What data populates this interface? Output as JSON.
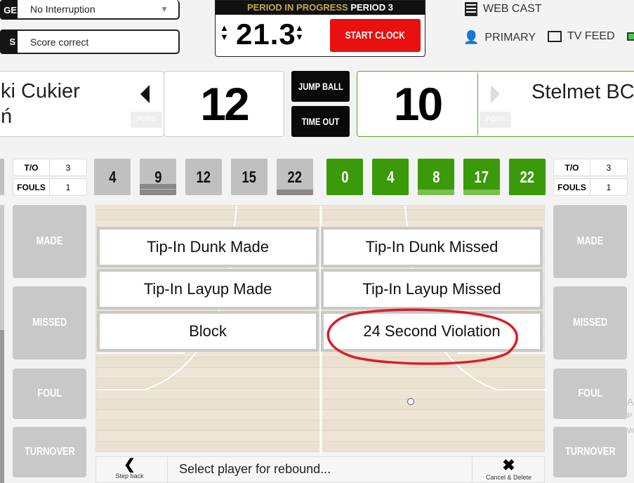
{
  "top_left": {
    "row1": {
      "label": "GE",
      "value": "No Interruption",
      "arrow": "▼"
    },
    "row2": {
      "label": "S",
      "value": "Score correct"
    }
  },
  "clock": {
    "status": "PERIOD IN PROGRESS",
    "period": "PERIOD 3",
    "time": "21.3",
    "start_label": "START CLOCK"
  },
  "top_right": {
    "webcast": "WEB CAST",
    "primary": "PRIMARY",
    "tv_feed": "TV FEED"
  },
  "home": {
    "name_line1": "ki Cukier",
    "name_line2": "ń",
    "score": "12",
    "poss": "POSS",
    "to_label": "T/O",
    "to": "3",
    "fouls_label": "FOULS",
    "fouls": "1",
    "players": [
      "4",
      "9",
      "12",
      "15",
      "22"
    ]
  },
  "away": {
    "name": "Stelmet BC Z",
    "score": "10",
    "poss": "POSS",
    "to_label": "T/O",
    "to": "3",
    "fouls_label": "FOULS",
    "fouls": "1",
    "players": [
      "0",
      "4",
      "8",
      "17",
      "22"
    ]
  },
  "center_buttons": {
    "jump_ball": "JUMP BALL",
    "time_out": "TIME OUT"
  },
  "side_buttons": [
    "MADE",
    "MISSED",
    "FOUL",
    "TURNOVER"
  ],
  "actions": [
    "Tip-In Dunk Made",
    "Tip-In Dunk Missed",
    "Tip-In Layup Made",
    "Tip-In Layup Missed",
    "Block",
    "24 Second Violation"
  ],
  "bottom": {
    "step_back": "Step back",
    "prompt": "Select player for rebound...",
    "cancel": "Cancel & Delete"
  },
  "edge_text": [
    "A",
    "P",
    "W"
  ],
  "colors": {
    "accent_green": "#3a9a0a",
    "start_red": "#e81010",
    "annotation_red": "#d81f26",
    "period_gold": "#c8a84a"
  }
}
